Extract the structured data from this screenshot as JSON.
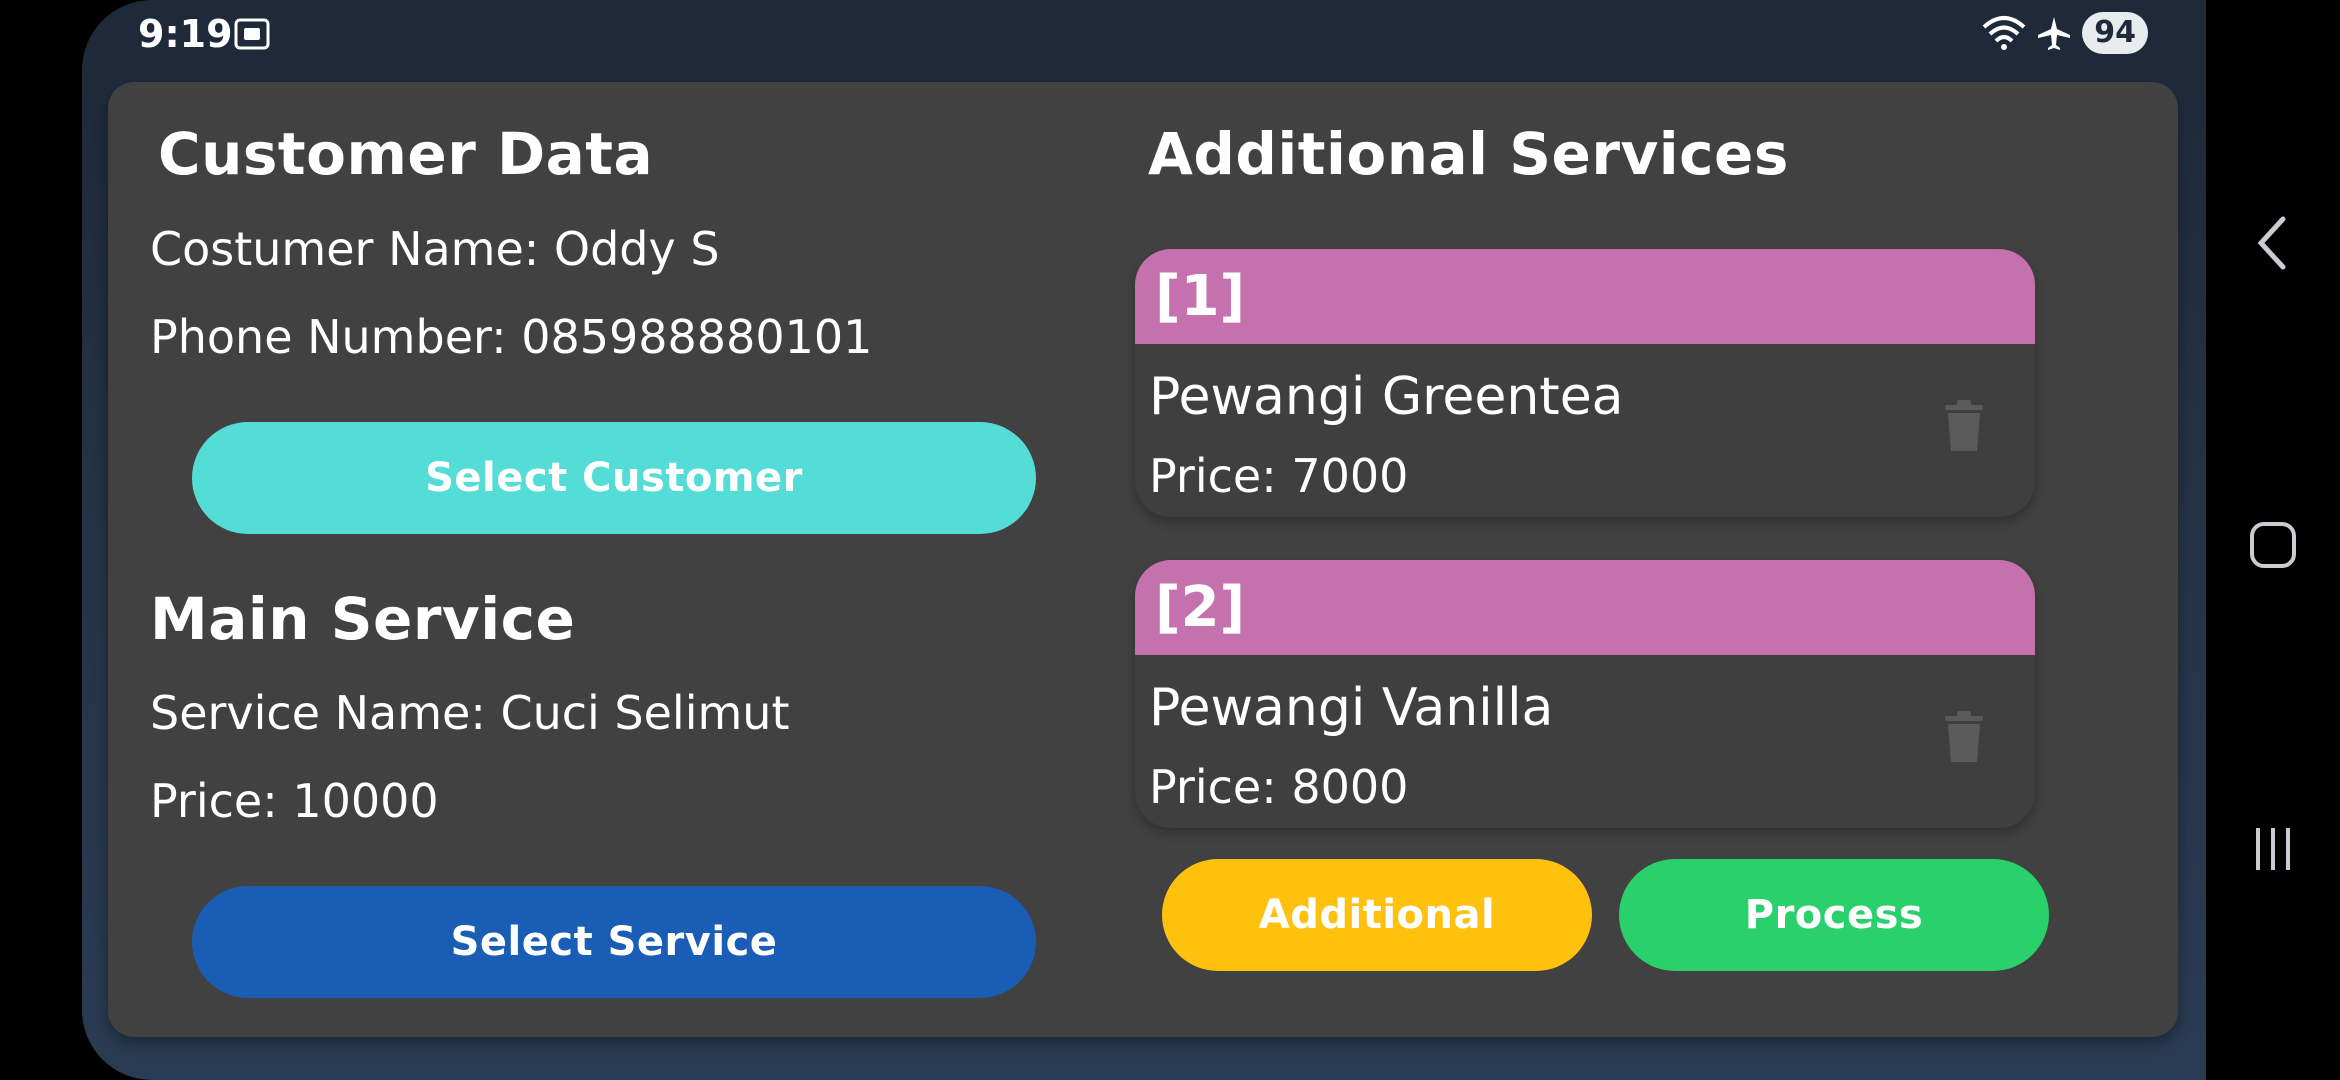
{
  "status": {
    "time": "9:19",
    "battery": "94"
  },
  "customer": {
    "heading": "Customer Data",
    "name_line": "Costumer Name: Oddy S",
    "phone_line": "Phone Number: 085988880101",
    "select_label": "Select Customer"
  },
  "main_service": {
    "heading": "Main Service",
    "name_line": "Service Name: Cuci Selimut",
    "price_line": "Price: 10000",
    "select_label": "Select Service"
  },
  "additional": {
    "heading": "Additional Services",
    "items": [
      {
        "index": "[1]",
        "name": "Pewangi Greentea",
        "price": "Price:  7000"
      },
      {
        "index": "[2]",
        "name": "Pewangi Vanilla",
        "price": "Price:  8000"
      }
    ],
    "add_label": "Additional",
    "process_label": "Process"
  },
  "colors": {
    "cyan": "#54ddd6",
    "blue": "#1a5db5",
    "pink": "#c571ad",
    "yellow": "#fec10e",
    "green": "#29d06b"
  }
}
